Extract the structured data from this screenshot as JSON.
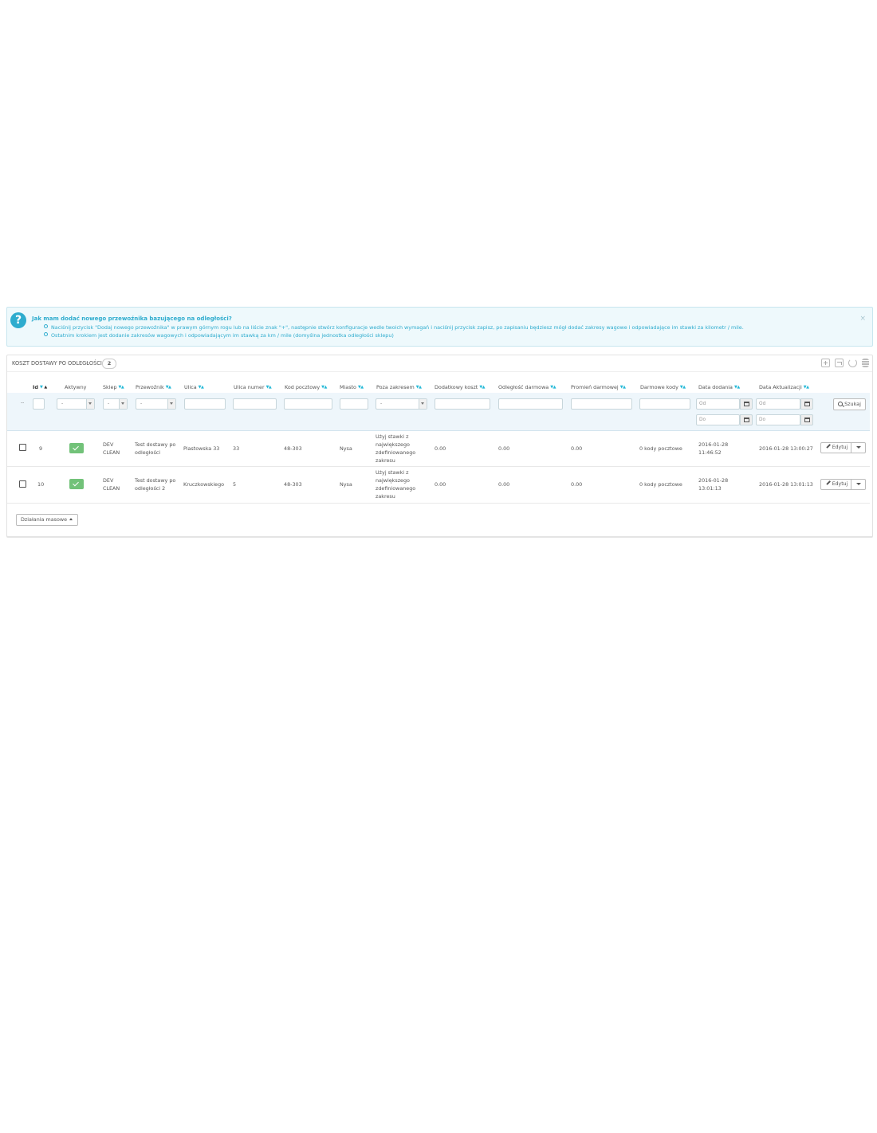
{
  "alert": {
    "title": "Jak mam dodać nowego przewoźnika bazującego na odległości?",
    "items": [
      "Naciśnij przycisk \"Dodaj nowego przewoźnika\" w prawym górnym rogu lub na liście znak \"+\", następnie stwórz konfiguracje wedle twoich wymagań i naciśnij przycisk zapisz, po zapisaniu będziesz mógł dodać zakresy wagowe i odpowiadające im stawki za kilometr / mile.",
      "Ostatnim krokiem jest dodanie zakresów wagowych i odpowiadającym im stawką za km / mile (domyślna jednostka odległości sklepu)"
    ],
    "close": "×"
  },
  "panel": {
    "title": "Koszt dostawy po odległości",
    "count": "2"
  },
  "columns": {
    "id": "Id",
    "active": "Aktywny",
    "shop": "Sklep",
    "carrier": "Przewoźnik",
    "street": "Ulica",
    "street_number": "Ulica numer",
    "postcode": "Kod pocztowy",
    "city": "Miasto",
    "out_of_range": "Poza zakresem",
    "extra_cost": "Dodatkowy koszt",
    "free_distance": "Odległość darmowa",
    "free_radius": "Promień darmowej",
    "free_codes": "Darmowe kody",
    "date_add": "Data dodania",
    "date_upd": "Data Aktualizacji"
  },
  "filters": {
    "dash": "--",
    "select_default": "-",
    "date_from": "Od",
    "date_to": "Do",
    "search_label": "Szukaj"
  },
  "rows": [
    {
      "id": "9",
      "shop": "DEV CLEAN",
      "carrier": "Test dostawy po odległości",
      "street": "Piastowska 33",
      "street_number": "33",
      "postcode": "48-303",
      "city": "Nysa",
      "out_of_range": "Użyj stawki z największego zdefiniowanego zakresu",
      "extra_cost": "0.00",
      "free_distance": "0.00",
      "free_radius": "0.00",
      "free_codes": "0 kody pocztowe",
      "date_add": "2016-01-28 11:46:52",
      "date_upd": "2016-01-28 13:00:27",
      "edit": "Edytuj"
    },
    {
      "id": "10",
      "shop": "DEV CLEAN",
      "carrier": "Test dostawy po odległości 2",
      "street": "Kruczkowskiego",
      "street_number": "5",
      "postcode": "48-303",
      "city": "Nysa",
      "out_of_range": "Użyj stawki z największego zdefiniowanego zakresu",
      "extra_cost": "0.00",
      "free_distance": "0.00",
      "free_radius": "0.00",
      "free_codes": "0 kody pocztowe",
      "date_add": "2016-01-28 13:01:13",
      "date_upd": "2016-01-28 13:01:13",
      "edit": "Edytuj"
    }
  ],
  "bulk_actions": "Działania masowe",
  "colors": {
    "accent": "#25b9d7",
    "info_text": "#2eacce",
    "active_badge": "#72c279"
  }
}
